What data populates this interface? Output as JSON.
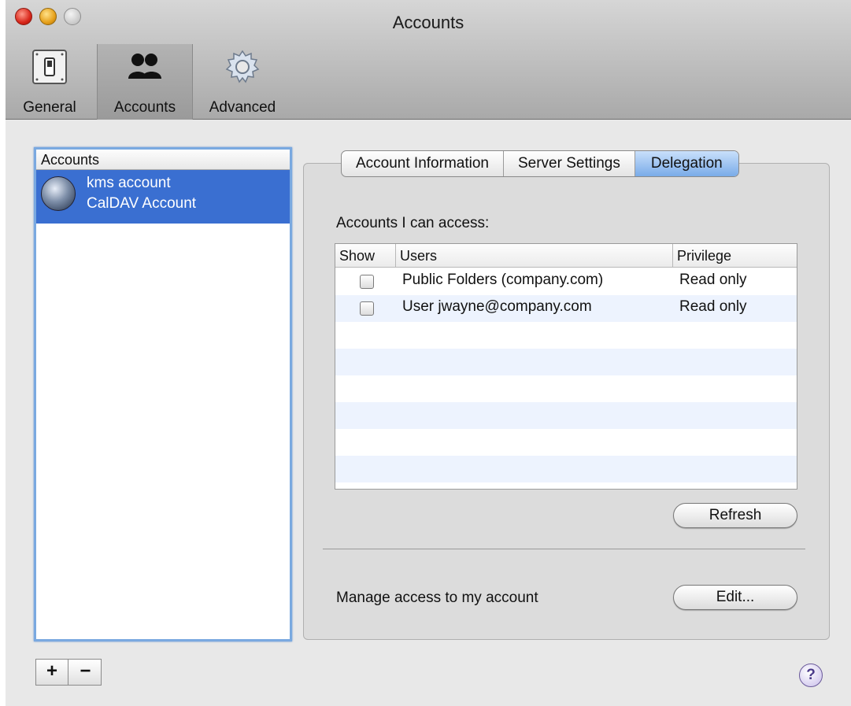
{
  "window": {
    "title": "Accounts"
  },
  "toolbar": {
    "items": [
      {
        "label": "General",
        "icon": "switch-icon"
      },
      {
        "label": "Accounts",
        "icon": "users-icon",
        "selected": true
      },
      {
        "label": "Advanced",
        "icon": "gear-icon"
      }
    ]
  },
  "accounts_list": {
    "header": "Accounts",
    "items": [
      {
        "name": "kms account",
        "type": "CalDAV Account",
        "icon": "globe-icon",
        "selected": true
      }
    ]
  },
  "tabs": [
    {
      "label": "Account Information",
      "active": false
    },
    {
      "label": "Server Settings",
      "active": false
    },
    {
      "label": "Delegation",
      "active": true
    }
  ],
  "delegation": {
    "access_label": "Accounts I can access:",
    "columns": {
      "show": "Show",
      "users": "Users",
      "privilege": "Privilege"
    },
    "rows": [
      {
        "show": false,
        "user": "Public Folders (company.com)",
        "privilege": "Read only"
      },
      {
        "show": false,
        "user": "User jwayne@company.com",
        "privilege": "Read only"
      }
    ],
    "refresh_label": "Refresh",
    "manage_label": "Manage access to my account",
    "edit_label": "Edit..."
  },
  "footer": {
    "add_label": "+",
    "remove_label": "−",
    "help_label": "?"
  },
  "colors": {
    "selection": "#3a6fd1",
    "active_tab": "#79abe8",
    "focus_ring": "#7aa9e0"
  }
}
